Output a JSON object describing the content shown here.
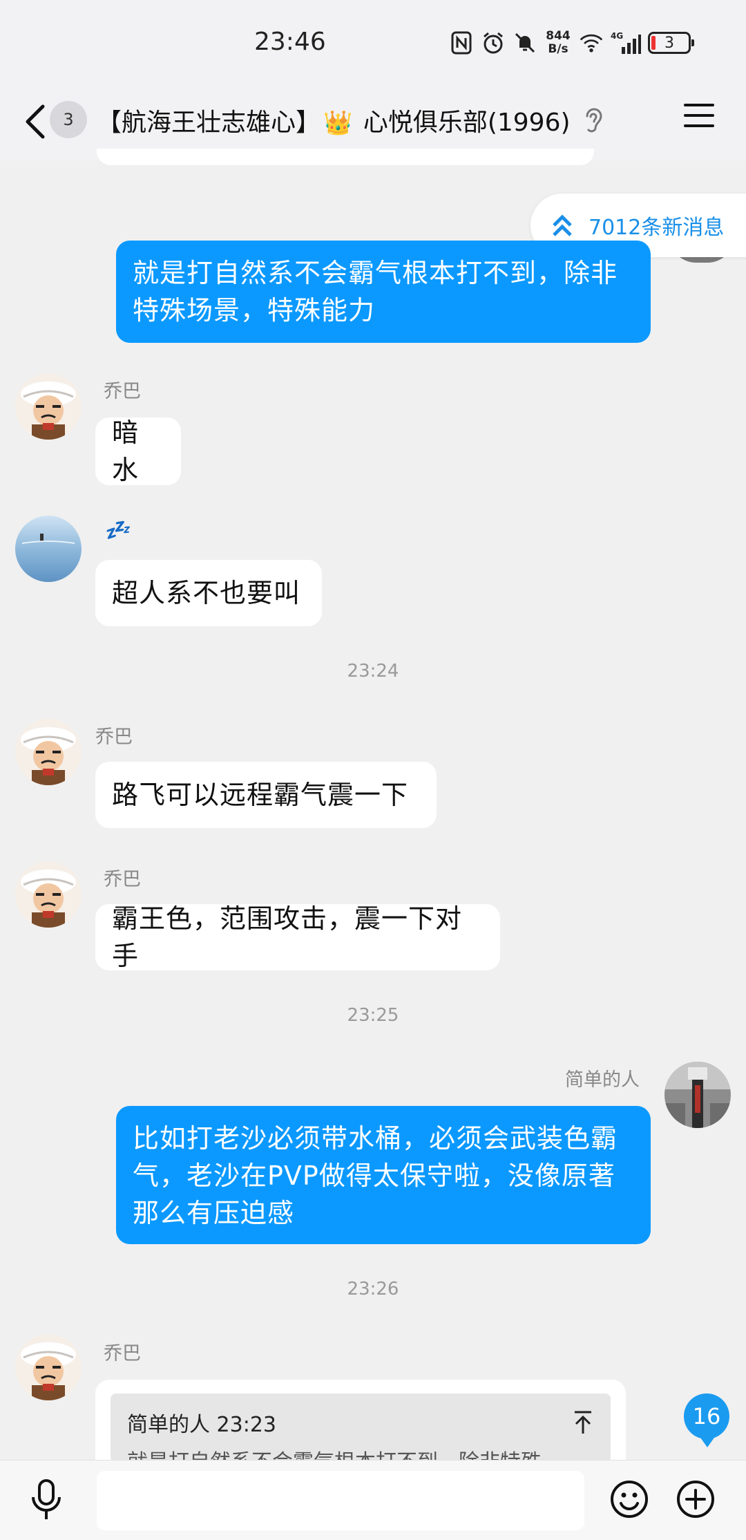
{
  "status_bar": {
    "time": "23:46",
    "net_speed_value": "844",
    "net_speed_unit": "B/s",
    "network_type": "4G",
    "battery": "3"
  },
  "header": {
    "back_count": "3",
    "group_title_a": "【航海王壮志雄心】",
    "group_title_b": "心悦俱乐部(1996)"
  },
  "new_messages": {
    "label": "7012条新消息"
  },
  "messages": [
    {
      "type": "out",
      "text_line1": "就是打自然系不会霸气根本打不到，除非",
      "text_line2": "特殊场景，特殊能力"
    },
    {
      "type": "in",
      "sender": "乔巴",
      "text": "暗水"
    },
    {
      "type": "in",
      "sender_emoji": "💤",
      "text": "超人系不也要叫"
    },
    {
      "type": "time",
      "text": "23:24"
    },
    {
      "type": "in",
      "sender": "乔巴",
      "text": "路飞可以远程霸气震一下"
    },
    {
      "type": "in",
      "sender": "乔巴",
      "text": "霸王色，范围攻击，震一下对手"
    },
    {
      "type": "time",
      "text": "23:25"
    },
    {
      "type": "out",
      "sender": "简单的人",
      "text_line1": "比如打老沙必须带水桶，必须会武装色霸",
      "text_line2": "气，老沙在PVP做得太保守啦，没像原著",
      "text_line3": "那么有压迫感"
    },
    {
      "type": "time",
      "text": "23:26"
    },
    {
      "type": "in",
      "sender": "乔巴",
      "quote_head": "简单的人 23:23",
      "quote_body": "就是打自然系不会霸气根本打不到，除非特殊"
    }
  ],
  "unread_count": "16",
  "input": {
    "placeholder": ""
  },
  "colors": {
    "outgoing_bubble": "#0b99ff",
    "accent": "#1a8fe8"
  }
}
